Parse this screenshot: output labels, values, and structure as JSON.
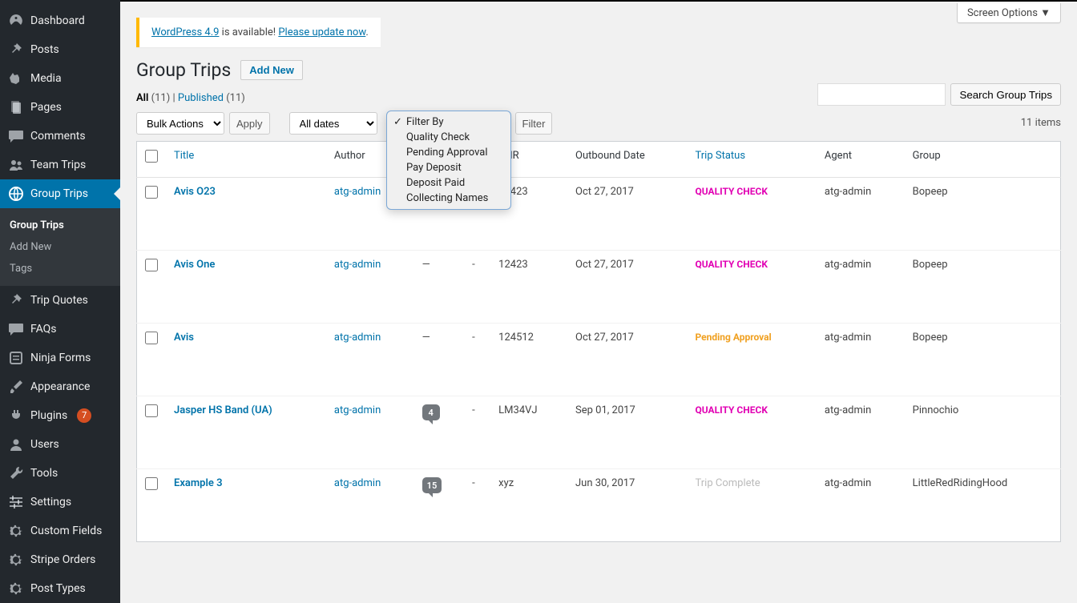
{
  "sidebar": {
    "items": [
      {
        "label": "Dashboard",
        "icon": "dashboard"
      },
      {
        "label": "Posts",
        "icon": "pin"
      },
      {
        "label": "Media",
        "icon": "media"
      },
      {
        "label": "Pages",
        "icon": "page"
      },
      {
        "label": "Comments",
        "icon": "comment"
      },
      {
        "label": "Team Trips",
        "icon": "users"
      },
      {
        "label": "Group Trips",
        "icon": "globe",
        "active": true
      },
      {
        "label": "Trip Quotes",
        "icon": "pin"
      },
      {
        "label": "FAQs",
        "icon": "comment"
      },
      {
        "label": "Ninja Forms",
        "icon": "form"
      },
      {
        "label": "Appearance",
        "icon": "brush"
      },
      {
        "label": "Plugins",
        "icon": "plug",
        "badge": "7"
      },
      {
        "label": "Users",
        "icon": "user"
      },
      {
        "label": "Tools",
        "icon": "wrench"
      },
      {
        "label": "Settings",
        "icon": "sliders"
      },
      {
        "label": "Custom Fields",
        "icon": "gear"
      },
      {
        "label": "Stripe Orders",
        "icon": "gear"
      },
      {
        "label": "Post Types",
        "icon": "gear"
      }
    ],
    "submenu": [
      {
        "label": "Group Trips",
        "current": true
      },
      {
        "label": "Add New"
      },
      {
        "label": "Tags"
      }
    ]
  },
  "screen_options": "Screen Options",
  "notice": {
    "link1": "WordPress 4.9",
    "mid": " is available! ",
    "link2": "Please update now",
    "tail": "."
  },
  "heading": "Group Trips",
  "add_new": "Add New",
  "subsub": {
    "all_label": "All",
    "all_count": "(11)",
    "sep": "  |  ",
    "published_label": "Published",
    "published_count": "(11)"
  },
  "toolbar": {
    "bulk": "Bulk Actions",
    "apply": "Apply",
    "dates": "All dates",
    "filter_by_selected": "Filter By",
    "filter": "Filter"
  },
  "filter_options": [
    "Filter By",
    "Quality Check",
    "Pending Approval",
    "Pay Deposit",
    "Deposit Paid",
    "Collecting Names"
  ],
  "search": {
    "button": "Search Group Trips"
  },
  "items_count": "11 items",
  "columns": {
    "title": "Title",
    "author": "Author",
    "pnr": "PNR",
    "outbound": "Outbound Date",
    "status": "Trip Status",
    "agent": "Agent",
    "group": "Group"
  },
  "rows": [
    {
      "title": "Avis O23",
      "author": "atg-admin",
      "comments": "—",
      "extra": "-",
      "pnr": "12423",
      "outbound": "Oct 27, 2017",
      "status": "QUALITY CHECK",
      "status_class": "qc",
      "agent": "atg-admin",
      "group": "Bopeep"
    },
    {
      "title": "Avis One",
      "author": "atg-admin",
      "comments": "—",
      "extra": "-",
      "pnr": "12423",
      "outbound": "Oct 27, 2017",
      "status": "QUALITY CHECK",
      "status_class": "qc",
      "agent": "atg-admin",
      "group": "Bopeep"
    },
    {
      "title": "Avis",
      "author": "atg-admin",
      "comments": "—",
      "extra": "-",
      "pnr": "124512",
      "outbound": "Oct 27, 2017",
      "status": "Pending Approval",
      "status_class": "pending",
      "agent": "atg-admin",
      "group": "Bopeep"
    },
    {
      "title": "Jasper HS Band (UA)",
      "author": "atg-admin",
      "comments": "4",
      "extra": "-",
      "pnr": "LM34VJ",
      "outbound": "Sep 01, 2017",
      "status": "QUALITY CHECK",
      "status_class": "qc",
      "agent": "atg-admin",
      "group": "Pinnochio"
    },
    {
      "title": "Example 3",
      "author": "atg-admin",
      "comments": "15",
      "extra": "-",
      "pnr": "xyz",
      "outbound": "Jun 30, 2017",
      "status": "Trip Complete",
      "status_class": "complete",
      "agent": "atg-admin",
      "group": "LittleRedRidingHood"
    }
  ]
}
